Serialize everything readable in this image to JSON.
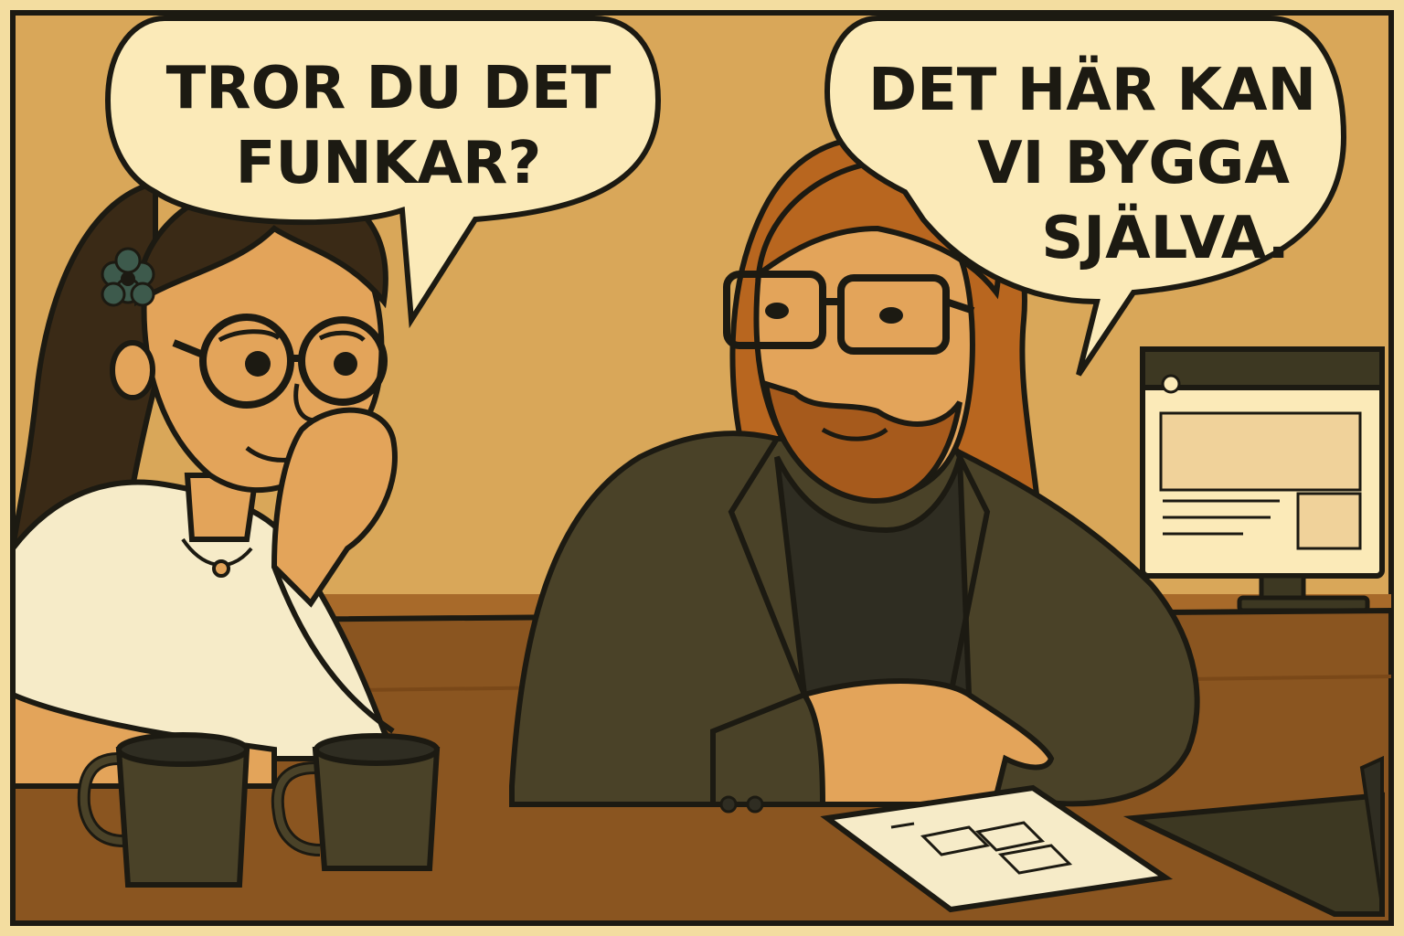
{
  "bubbles": {
    "left": {
      "line1": "TROR DU DET",
      "line2": "FUNKAR?"
    },
    "right": {
      "line1": "DET HÄR KAN",
      "line2": "VI BYGGA",
      "line3": "SJÄLVA."
    }
  },
  "colors": {
    "wall": "#d9a759",
    "desk": "#8a5520",
    "outline": "#1c1a12",
    "bubble": "#fbeab8",
    "jacket": "#4a4228",
    "hair_man": "#b8661f",
    "hair_woman": "#3a2a16"
  }
}
